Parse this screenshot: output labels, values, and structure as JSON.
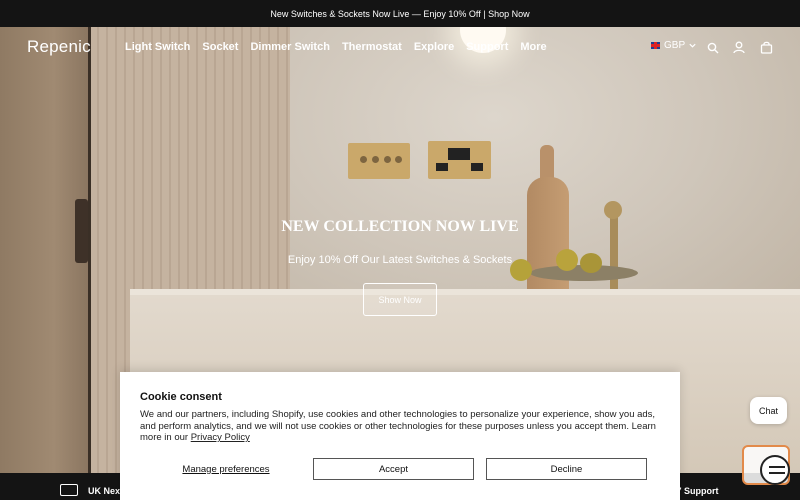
{
  "announcement": {
    "text": "New Switches & Sockets Now Live — Enjoy 10% Off | Shop Now"
  },
  "header": {
    "logo": "Repenic",
    "menu": [
      "Light Switch",
      "Socket",
      "Dimmer Switch",
      "Thermostat",
      "Explore",
      "Support",
      "More"
    ],
    "currency": "GBP",
    "icons": [
      "search-icon",
      "account-icon",
      "cart-icon"
    ]
  },
  "hero": {
    "title": "NEW COLLECTION NOW LIVE",
    "subtitle": "Enjoy 10% Off Our Latest Switches & Sockets",
    "button_label": "Show Now"
  },
  "bottom_strip": {
    "left": "UK Nex",
    "right": "/7 Support"
  },
  "cookie": {
    "title": "Cookie consent",
    "text": "We and our partners, including Shopify, use cookies and other technologies to personalize your experience, show you ads, and perform analytics, and we will not use cookies or other technologies for these purposes unless you accept them. Learn more in our",
    "link": "Privacy Policy",
    "manage_label": "Manage preferences",
    "accept_label": "Accept",
    "decline_label": "Decline"
  },
  "chat": {
    "label": "Chat"
  },
  "colors": {
    "bar": "#141414",
    "accent": "#e28a4a",
    "brass": "#caa86a"
  }
}
